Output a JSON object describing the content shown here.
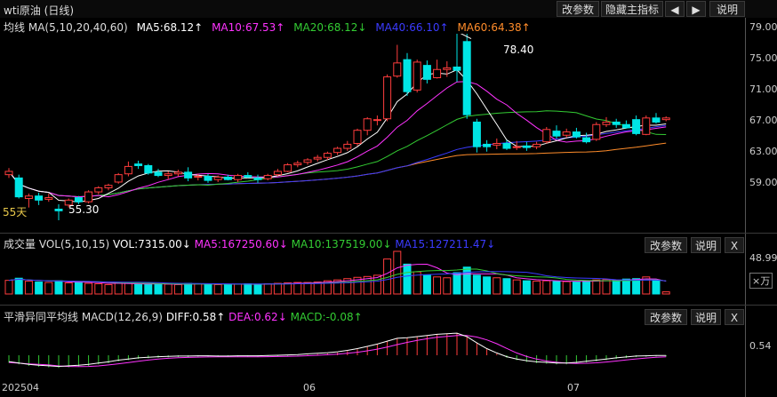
{
  "colors": {
    "up": "#ff3d3d",
    "down": "#00e5e5",
    "ma5": "#ffffff",
    "ma10": "#ff33ff",
    "ma20": "#33cc33",
    "ma40": "#3b3bff",
    "ma60": "#ff8c2a",
    "text": "#cccccc",
    "accent_yellow": "#e8c84a"
  },
  "top": {
    "title": "wti原油 (日线)",
    "buttons": [
      "改参数",
      "隐藏主指标",
      "◀",
      "▶",
      "说明"
    ]
  },
  "main": {
    "label": "均线",
    "ma_params": "MA(5,10,20,40,60)",
    "ma5": "MA5:68.12↑",
    "ma10": "MA10:67.53↑",
    "ma20": "MA20:68.12↓",
    "ma40": "MA40:66.10↑",
    "ma60": "MA60:64.38↑",
    "y_ticks": [
      "79.00",
      "75.00",
      "71.00",
      "67.00",
      "63.00",
      "59.00"
    ],
    "high_label": "78.40",
    "low_label": "55.30",
    "days_label": "55天"
  },
  "volume": {
    "label": "成交量",
    "params": "VOL(5,10,15)",
    "vol": "VOL:7315.00↓",
    "ma5": "MA5:167250.60↓",
    "ma10": "MA10:137519.00↓",
    "ma15": "MA15:127211.47↓",
    "y_tick": "48.99",
    "unit": "×万",
    "buttons": [
      "改参数",
      "说明",
      "X"
    ]
  },
  "macd": {
    "label": "平滑异同平均线",
    "params": "MACD(12,26,9)",
    "diff": "DIFF:0.58↑",
    "dea": "DEA:0.62↓",
    "macd": "MACD:-0.08↑",
    "y_tick": "0.54",
    "buttons": [
      "改参数",
      "说明",
      "X"
    ]
  },
  "x_labels": [
    "202504",
    "06",
    "07"
  ],
  "chart_data": {
    "type": "candlestick",
    "y_range": [
      55,
      79
    ],
    "candles": [
      [
        61.2,
        62.0,
        60.8,
        61.6
      ],
      [
        60.8,
        61.2,
        58.3,
        58.5
      ],
      [
        58.3,
        58.9,
        57.2,
        58.6
      ],
      [
        58.6,
        59.0,
        57.5,
        58.1
      ],
      [
        58.2,
        58.9,
        57.9,
        58.4
      ],
      [
        57.0,
        57.6,
        55.3,
        56.8
      ],
      [
        57.5,
        58.3,
        57.2,
        58.1
      ],
      [
        58.4,
        58.6,
        57.6,
        57.9
      ],
      [
        57.9,
        59.3,
        57.7,
        59.1
      ],
      [
        59.1,
        59.8,
        58.8,
        59.6
      ],
      [
        59.6,
        60.1,
        59.3,
        59.9
      ],
      [
        60.3,
        61.4,
        60.1,
        61.2
      ],
      [
        61.3,
        62.8,
        61.0,
        62.2
      ],
      [
        62.5,
        62.9,
        61.9,
        62.3
      ],
      [
        62.3,
        62.5,
        61.2,
        61.4
      ],
      [
        61.5,
        61.9,
        60.9,
        61.1
      ],
      [
        61.1,
        61.6,
        60.6,
        61.3
      ],
      [
        61.3,
        61.8,
        61.0,
        61.5
      ],
      [
        61.5,
        62.1,
        60.4,
        60.8
      ],
      [
        60.9,
        61.3,
        60.5,
        61.0
      ],
      [
        61.0,
        61.3,
        60.2,
        60.5
      ],
      [
        60.6,
        61.1,
        60.3,
        60.9
      ],
      [
        60.9,
        61.2,
        60.5,
        60.6
      ],
      [
        60.6,
        61.3,
        60.3,
        61.1
      ],
      [
        61.1,
        61.5,
        60.8,
        60.9
      ],
      [
        60.8,
        61.2,
        60.2,
        60.6
      ],
      [
        60.7,
        61.3,
        60.5,
        61.1
      ],
      [
        61.2,
        61.9,
        61.0,
        61.6
      ],
      [
        61.6,
        62.6,
        61.5,
        62.4
      ],
      [
        62.4,
        62.9,
        62.1,
        62.6
      ],
      [
        62.7,
        63.2,
        62.4,
        63.0
      ],
      [
        63.1,
        63.6,
        62.8,
        63.3
      ],
      [
        63.3,
        64.0,
        63.0,
        63.8
      ],
      [
        63.9,
        64.6,
        63.6,
        64.4
      ],
      [
        64.4,
        65.3,
        64.1,
        64.9
      ],
      [
        65.0,
        66.8,
        64.7,
        66.6
      ],
      [
        66.6,
        68.2,
        66.0,
        68.0
      ],
      [
        67.8,
        68.4,
        67.2,
        67.9
      ],
      [
        68.0,
        73.4,
        67.7,
        73.1
      ],
      [
        73.2,
        77.0,
        73.0,
        74.8
      ],
      [
        75.2,
        76.0,
        70.8,
        71.3
      ],
      [
        71.5,
        75.2,
        71.2,
        74.9
      ],
      [
        74.5,
        75.1,
        72.3,
        72.8
      ],
      [
        73.0,
        75.2,
        72.9,
        74.0
      ],
      [
        74.0,
        75.0,
        73.1,
        74.2
      ],
      [
        74.3,
        78.4,
        72.5,
        73.9
      ],
      [
        77.4,
        78.4,
        68.0,
        68.5
      ],
      [
        67.6,
        68.0,
        63.9,
        64.6
      ],
      [
        64.9,
        65.4,
        64.0,
        64.6
      ],
      [
        64.8,
        65.6,
        64.3,
        65.0
      ],
      [
        65.0,
        65.4,
        64.2,
        64.4
      ],
      [
        64.6,
        65.3,
        64.2,
        64.6
      ],
      [
        64.7,
        65.2,
        64.1,
        64.5
      ],
      [
        64.6,
        65.2,
        64.3,
        64.9
      ],
      [
        65.2,
        67.0,
        65.0,
        66.7
      ],
      [
        66.5,
        67.2,
        65.6,
        65.9
      ],
      [
        66.0,
        66.8,
        65.7,
        66.4
      ],
      [
        66.4,
        66.9,
        65.6,
        65.8
      ],
      [
        65.7,
        66.3,
        65.0,
        65.2
      ],
      [
        65.5,
        67.6,
        65.3,
        67.3
      ],
      [
        67.3,
        68.2,
        67.0,
        67.6
      ],
      [
        67.6,
        68.0,
        66.9,
        67.3
      ],
      [
        67.3,
        67.8,
        66.8,
        66.9
      ],
      [
        67.9,
        68.4,
        66.0,
        66.2
      ],
      [
        66.1,
        68.4,
        66.0,
        68.1
      ],
      [
        68.1,
        68.7,
        67.4,
        67.6
      ],
      [
        67.9,
        68.3,
        67.7,
        68.1
      ]
    ],
    "volume": [
      0.32,
      0.37,
      0.3,
      0.28,
      0.27,
      0.31,
      0.26,
      0.28,
      0.25,
      0.24,
      0.22,
      0.26,
      0.25,
      0.23,
      0.22,
      0.24,
      0.23,
      0.22,
      0.25,
      0.24,
      0.24,
      0.22,
      0.22,
      0.23,
      0.24,
      0.23,
      0.24,
      0.25,
      0.26,
      0.27,
      0.27,
      0.28,
      0.31,
      0.33,
      0.36,
      0.39,
      0.41,
      0.44,
      0.82,
      1.0,
      0.7,
      0.52,
      0.45,
      0.4,
      0.38,
      0.5,
      0.63,
      0.44,
      0.4,
      0.38,
      0.36,
      0.33,
      0.31,
      0.3,
      0.31,
      0.3,
      0.29,
      0.28,
      0.31,
      0.33,
      0.34,
      0.32,
      0.35,
      0.36,
      0.4,
      0.33,
      0.05
    ],
    "macd_hist": [
      -0.25,
      -0.3,
      -0.35,
      -0.38,
      -0.4,
      -0.42,
      -0.4,
      -0.38,
      -0.35,
      -0.3,
      -0.26,
      -0.2,
      -0.16,
      -0.12,
      -0.1,
      -0.08,
      -0.07,
      -0.06,
      -0.06,
      -0.05,
      -0.05,
      -0.06,
      -0.06,
      -0.05,
      -0.05,
      -0.05,
      -0.04,
      -0.03,
      -0.02,
      -0.01,
      0.02,
      0.04,
      0.06,
      0.09,
      0.14,
      0.2,
      0.28,
      0.36,
      0.46,
      0.56,
      0.58,
      0.62,
      0.66,
      0.7,
      0.72,
      0.74,
      0.62,
      0.4,
      0.2,
      0.05,
      -0.08,
      -0.16,
      -0.22,
      -0.26,
      -0.28,
      -0.3,
      -0.3,
      -0.28,
      -0.24,
      -0.2,
      -0.16,
      -0.12,
      -0.09,
      -0.06,
      -0.05,
      -0.04,
      -0.04
    ]
  }
}
